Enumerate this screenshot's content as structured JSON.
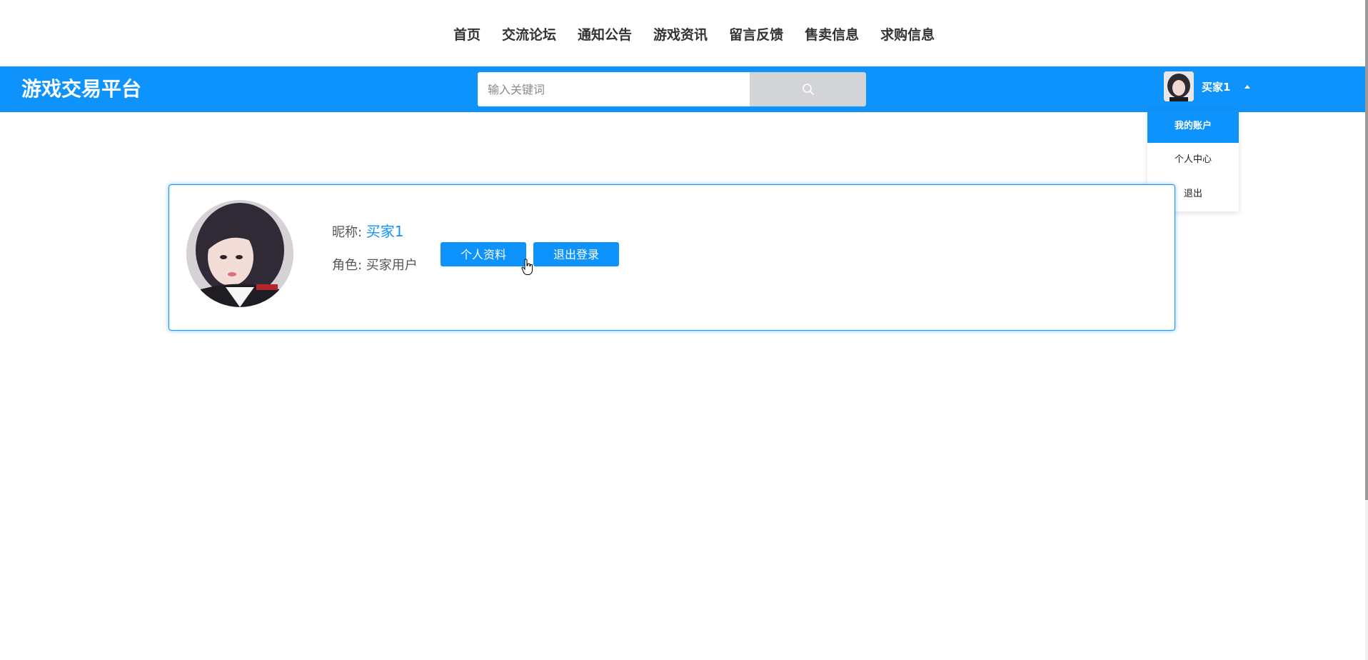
{
  "nav": {
    "items": [
      {
        "label": "首页"
      },
      {
        "label": "交流论坛"
      },
      {
        "label": "通知公告"
      },
      {
        "label": "游戏资讯"
      },
      {
        "label": "留言反馈"
      },
      {
        "label": "售卖信息"
      },
      {
        "label": "求购信息"
      }
    ]
  },
  "header": {
    "brand": "游戏交易平台",
    "search_placeholder": "输入关键词",
    "user_name": "买家1"
  },
  "dropdown": {
    "items": [
      {
        "label": "我的账户",
        "active": true
      },
      {
        "label": "个人中心"
      },
      {
        "label": "退出"
      }
    ]
  },
  "profile": {
    "nickname_label": "昵称: ",
    "nickname_value": "买家1",
    "role_label": "角色: ",
    "role_value": "买家用户",
    "btn_profile": "个人资料",
    "btn_logout": "退出登录"
  },
  "colors": {
    "primary": "#0d93fb",
    "search_button": "#d2d4d7"
  }
}
